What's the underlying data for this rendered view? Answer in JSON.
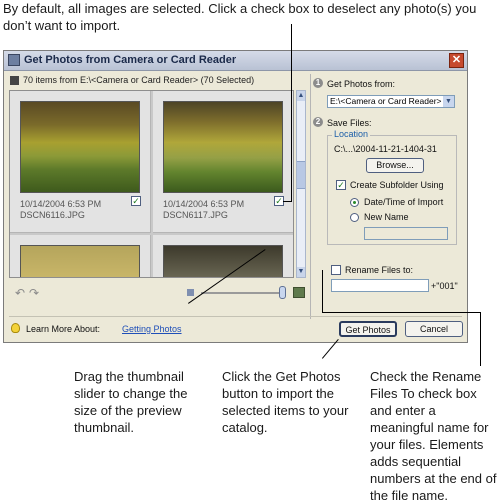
{
  "callouts": {
    "top": "By default, all images are selected. Click a check box to deselect any photo(s) you don’t want to import.",
    "slider": "Drag the thumbnail slider to change the size of the preview thumbnail.",
    "get_photos": "Click the Get Photos button to import the selected items to your catalog.",
    "rename": "Check the Rename Files To check box and enter a meaningful name for your files. Elements adds sequential numbers at the end of the file name."
  },
  "dialog": {
    "title": "Get Photos from Camera or Card Reader",
    "close_glyph": "✕",
    "items_summary": "70 items from E:\\<Camera or Card Reader> (70 Selected)",
    "thumbnails": [
      {
        "date": "10/14/2004 6:53 PM",
        "filename": "DSCN6116.JPG",
        "checked": true
      },
      {
        "date": "10/14/2004 6:53 PM",
        "filename": "DSCN6117.JPG",
        "checked": true
      },
      {
        "date": "",
        "filename": "",
        "checked": true
      },
      {
        "date": "",
        "filename": "",
        "checked": true
      }
    ],
    "thumbnail_slider_level": 0.95,
    "step1": {
      "number": "1",
      "label": "Get Photos from:",
      "source": "E:\\<Camera or Card Reader>"
    },
    "step2": {
      "number": "2",
      "label": "Save Files:",
      "location_legend": "Location",
      "location_path": "C:\\...\\2004-11-21-1404-31",
      "browse_label": "Browse...",
      "create_subfolder_label": "Create Subfolder Using",
      "create_subfolder_checked": true,
      "option_date": "Date/Time of Import",
      "option_new_name": "New Name",
      "selected_option": "date"
    },
    "rename": {
      "label": "Rename Files to:",
      "checked": false,
      "suffix": "+\"001\""
    },
    "footer": {
      "learn_label": "Learn More About:",
      "learn_link": "Getting Photos",
      "get_photos_label": "Get Photos",
      "cancel_label": "Cancel"
    },
    "check_glyph": "✓"
  }
}
